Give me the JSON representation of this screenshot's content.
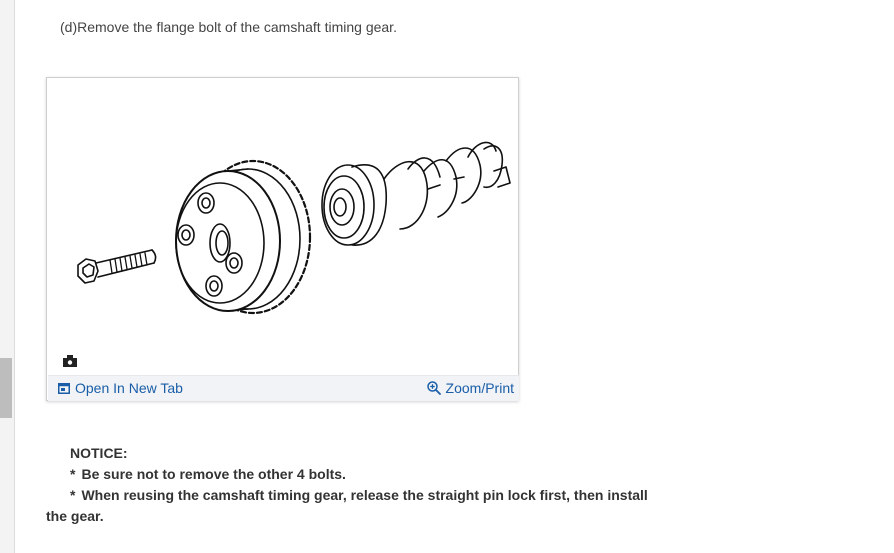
{
  "step": {
    "text": "(d)Remove the flange bolt of the camshaft timing gear."
  },
  "figure": {
    "marker_icon": "camera-icon",
    "actions": {
      "open_new_tab": {
        "label": "Open In New Tab",
        "icon": "new-tab-icon"
      },
      "zoom_print": {
        "label": "Zoom/Print",
        "icon": "zoom-in-icon"
      }
    }
  },
  "notice": {
    "title": "NOTICE:",
    "items": [
      {
        "bullet": "*",
        "text": "Be sure not to remove the other 4 bolts."
      },
      {
        "bullet": "*",
        "text": "When reusing the camshaft timing gear, release the straight pin lock first, then install the gear."
      }
    ]
  },
  "colors": {
    "link": "#1a5ea8",
    "footer_bg": "#f1f3f6",
    "text": "#333333"
  }
}
